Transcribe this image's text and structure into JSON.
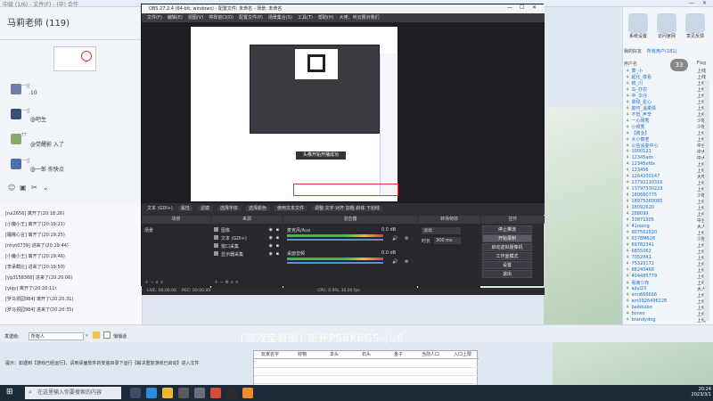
{
  "window_title": "中级 (1/6) - 文件(F) - (中) 合作",
  "chat": {
    "title": "马莉老师 (119)",
    "messages": [
      {
        "name": "一位",
        "text": "10",
        "color": "#6c7fa8"
      },
      {
        "name": "一位",
        "text": "@吧生",
        "color": "#3a4e7a"
      },
      {
        "name": "TT",
        "text": "@觉醒影 入了",
        "color": "#8aa86a"
      },
      {
        "name": "一位",
        "text": "@一郎 你快点",
        "color": "#4d6ea8"
      }
    ],
    "log_lines": [
      "[rui2656] 离开了(20:18:26)",
      "[小魔小王] 离开了(20:19:21)",
      "[睡瞳心言] 离开了(20:19:25)",
      "[nhyt0739] 进来了(20:19:44)",
      "[小魔小王] 离开了(20:19:46)",
      "[李承截比] 进来了(20:19:50)",
      "[yg3158368] 进来了(20:20:06)",
      "[yiqy] 离开了(20:20:11)",
      "[罗马领园984] 离开了(20:20:31)",
      "[罗马领园984] 进来了(20:20:35)"
    ],
    "send_label": "发送给:",
    "send_target": "所有人",
    "private_label": "悄悄话",
    "tips": "提示：如遇到【游戏已经运行】，请到桌面软件的安装目录下运行【解决重复游戏已启动】进入文件"
  },
  "obs": {
    "title": "OBS 27.2.4 (64-bit, windows) - 配置文件: 未命名 - 场景: 未命名",
    "menu": [
      "文件(F)",
      "编辑(E)",
      "视图(V)",
      "停靠窗口(D)",
      "配置文件(P)",
      "场景集合(S)",
      "工具(T)",
      "帮助(H)",
      "大佬，听云赛对我们"
    ],
    "preview_caption": "头像开始开播成功",
    "source_bar": [
      "文本 (GDI+)",
      "属性",
      "滤镜",
      "选择字体",
      "选择颜色",
      "使用文本文件",
      "调整  文字  对齐  加粗  斜体  下划线"
    ],
    "docks": {
      "scenes": "场景",
      "sources": "来源",
      "mixer": "混音器",
      "transitions": "转场特效",
      "controls": "控件"
    },
    "scene_item": "场景",
    "source_items": [
      "图像",
      "文本 (GDI+)",
      "窗口采集",
      "显示器采集"
    ],
    "mixer_items": [
      {
        "name": "麦克风/Aux",
        "db": "0.0 dB"
      },
      {
        "name": "桌面音频",
        "db": "0.0 dB"
      }
    ],
    "transition_type": "淡出",
    "transition_duration_label": "时长",
    "transition_duration": "300 ms",
    "control_buttons": [
      "停止推流",
      "开始录制",
      "启动虚拟摄像机",
      "工作室模式",
      "设置",
      "退出"
    ],
    "status": [
      "LIVE: 00:00:00",
      "REC: 00:00:00",
      "CPU: 0.9%, 30.00 fps"
    ]
  },
  "right_panel": {
    "icons": [
      {
        "label": "系统设置",
        "icon": "gear-icon"
      },
      {
        "label": "访问官网",
        "icon": "globe-icon"
      },
      {
        "label": "意见反馈",
        "icon": "feedback-icon"
      }
    ],
    "tabs": [
      "我的好友",
      "所有用户(181)"
    ],
    "badge": "33",
    "columns": [
      "用户名",
      "Flag"
    ],
    "users": [
      {
        "name": "萧_小",
        "status": "上线"
      },
      {
        "name": "起化_体看",
        "status": "上线"
      },
      {
        "name": "鲜_川",
        "status": "上线"
      },
      {
        "name": "鸟_亦衣",
        "status": "上线"
      },
      {
        "name": "中_伞仔",
        "status": "上线"
      },
      {
        "name": "翠绿_星心",
        "status": "上线"
      },
      {
        "name": "颜可_温柔情",
        "status": "上线"
      },
      {
        "name": "不低_声辛",
        "status": "上线"
      },
      {
        "name": "一心倾秀",
        "status": "少陪"
      },
      {
        "name": "小倾秀",
        "status": "少陪"
      },
      {
        "name": "【商业】",
        "status": "上线"
      },
      {
        "name": "大小丽老",
        "status": "上线"
      },
      {
        "name": "公信会委中心",
        "status": "中台"
      },
      {
        "name": "1000121",
        "status": "中大"
      },
      {
        "name": "12345adc",
        "status": "中大"
      },
      {
        "name": "12345xfdx",
        "status": "上线"
      },
      {
        "name": "123456",
        "status": "上线"
      },
      {
        "name": "1264200147",
        "status": "大吃"
      },
      {
        "name": "13792210316",
        "status": "上线"
      },
      {
        "name": "13797330223",
        "status": "上线"
      },
      {
        "name": "180660775",
        "status": "少陪"
      },
      {
        "name": "18975060085",
        "status": "上线"
      },
      {
        "name": "28092620",
        "status": "上线"
      },
      {
        "name": "288099",
        "status": "上线"
      },
      {
        "name": "33871305",
        "status": "中台"
      },
      {
        "name": "41ooing",
        "status": "大人"
      },
      {
        "name": "607562820",
        "status": "上线"
      },
      {
        "name": "6378M628",
        "status": "少陪"
      },
      {
        "name": "69782341",
        "status": "上线"
      },
      {
        "name": "6855062",
        "status": "上线"
      },
      {
        "name": "7052041",
        "status": "上线"
      },
      {
        "name": "75323172",
        "status": "上线"
      },
      {
        "name": "88240466",
        "status": "上线"
      },
      {
        "name": "404485779",
        "status": "上线"
      },
      {
        "name": "看旁少布",
        "status": "上线"
      },
      {
        "name": "ajiul23",
        "status": "大人"
      },
      {
        "name": "ann666666",
        "status": "上线"
      },
      {
        "name": "am0926496228",
        "status": "上线"
      },
      {
        "name": "baibbobo",
        "status": "上线"
      },
      {
        "name": "bones",
        "status": "上线"
      },
      {
        "name": "brandydog",
        "status": "上线"
      }
    ]
  },
  "table": {
    "columns": [
      "玩家名字",
      "财物",
      "本头",
      "石头",
      "金子",
      "当前人口",
      "入口上限"
    ]
  },
  "taskbar": {
    "search_placeholder": "在这里输入你要搜索的内容",
    "time": "20:24",
    "date": "2023/3/1"
  },
  "overlay_text": "[游戏宝截图] 新开PS6K6GS-JU6"
}
